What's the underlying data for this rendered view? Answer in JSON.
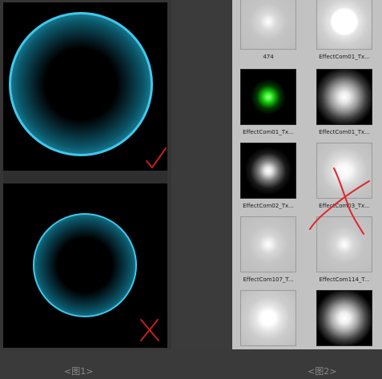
{
  "left_panel": {
    "top_preview": {
      "ring_color": "#3fc8ec",
      "mark_icon": "checkmark-icon",
      "mark_color": "#c41e1e"
    },
    "bottom_preview": {
      "ring_color": "#3fc8ec",
      "mark_icon": "cross-icon",
      "mark_color": "#c41e1e"
    }
  },
  "asset_browser": {
    "annotation_icon": "red-cross-icon",
    "items": [
      {
        "label": "474",
        "thumb": "light-small-glow"
      },
      {
        "label": "EffectCom01_Tx...",
        "thumb": "light-white-disc"
      },
      {
        "label": "EffectCom01_Tx...",
        "thumb": "dark-green-dot"
      },
      {
        "label": "EffectCom01_Tx...",
        "thumb": "dark-soft-glow"
      },
      {
        "label": "EffectCom02_Tx...",
        "thumb": "dark-small-glow"
      },
      {
        "label": "EffectCom03_Tx...",
        "thumb": "light-soft-glow"
      },
      {
        "label": "EffectCom107_T...",
        "thumb": "light-small-glow"
      },
      {
        "label": "EffectCom114_T...",
        "thumb": "light-small-glow"
      },
      {
        "label": "",
        "thumb": "light-big-glow"
      },
      {
        "label": "",
        "thumb": "dark-big-glow"
      }
    ]
  },
  "captions": {
    "left": "<图1>",
    "right": "<图2>"
  }
}
